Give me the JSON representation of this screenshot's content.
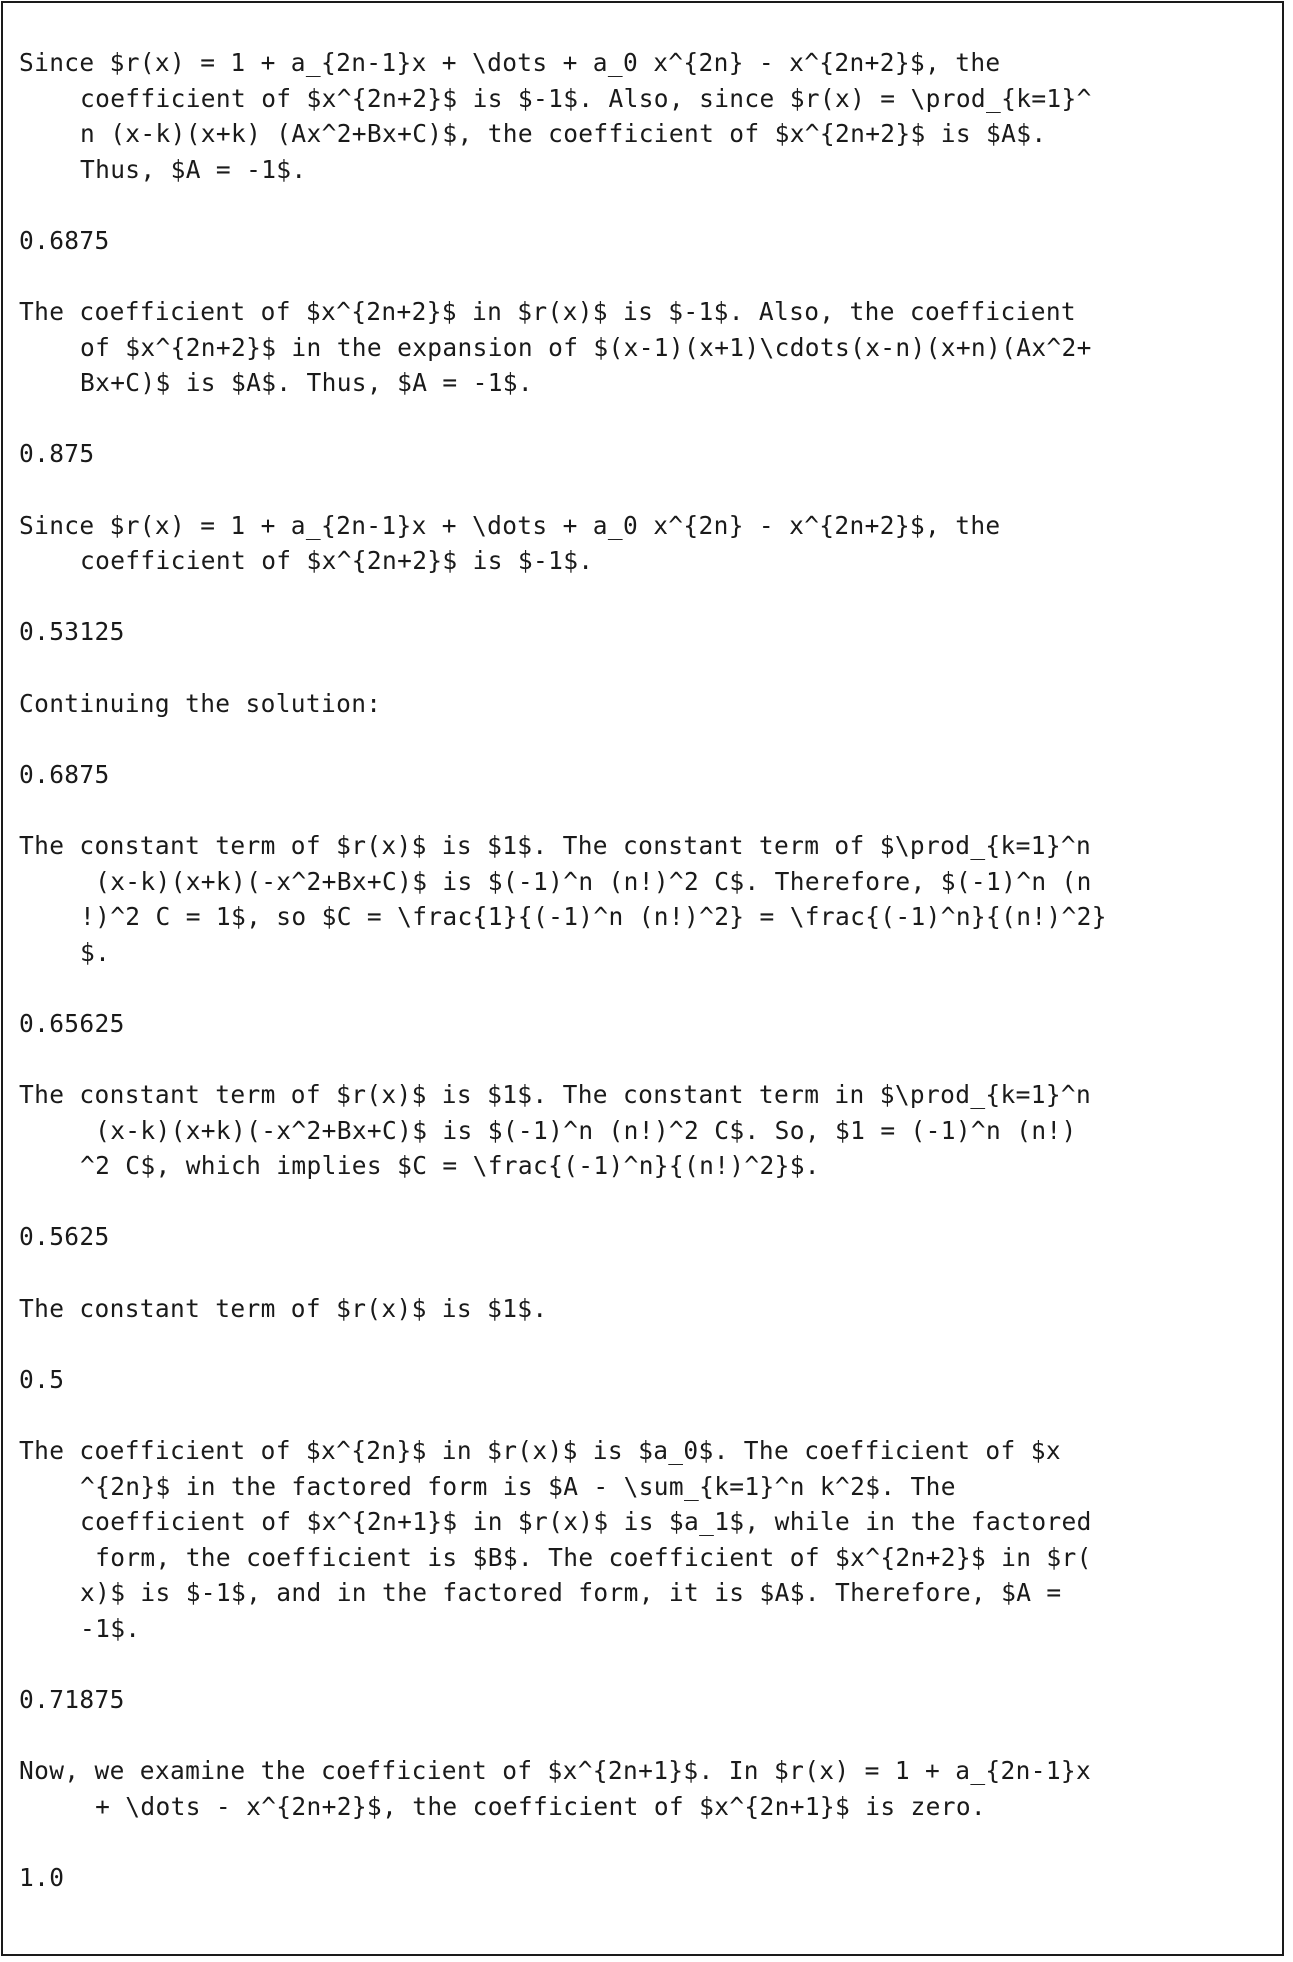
{
  "entries": [
    {
      "lines": [
        "Since $r(x) = 1 + a_{2n-1}x + \\dots + a_0 x^{2n} - x^{2n+2}$, the",
        "coefficient of $x^{2n+2}$ is $-1$. Also, since $r(x) = \\prod_{k=1}^",
        "n (x-k)(x+k) (Ax^2+Bx+C)$, the coefficient of $x^{2n+2}$ is $A$.",
        "Thus, $A = -1$."
      ],
      "score": "0.6875"
    },
    {
      "lines": [
        "The coefficient of $x^{2n+2}$ in $r(x)$ is $-1$. Also, the coefficient",
        "of $x^{2n+2}$ in the expansion of $(x-1)(x+1)\\cdots(x-n)(x+n)(Ax^2+",
        "Bx+C)$ is $A$. Thus, $A = -1$."
      ],
      "score": "0.875"
    },
    {
      "lines": [
        "Since $r(x) = 1 + a_{2n-1}x + \\dots + a_0 x^{2n} - x^{2n+2}$, the",
        "coefficient of $x^{2n+2}$ is $-1$."
      ],
      "score": "0.53125"
    },
    {
      "lines": [
        "Continuing the solution:"
      ],
      "score": "0.6875"
    },
    {
      "lines": [
        "The constant term of $r(x)$ is $1$. The constant term of $\\prod_{k=1}^n",
        " (x-k)(x+k)(-x^2+Bx+C)$ is $(-1)^n (n!)^2 C$. Therefore, $(-1)^n (n",
        "!)^2 C = 1$, so $C = \\frac{1}{(-1)^n (n!)^2} = \\frac{(-1)^n}{(n!)^2}",
        "$."
      ],
      "score": "0.65625"
    },
    {
      "lines": [
        "The constant term of $r(x)$ is $1$. The constant term in $\\prod_{k=1}^n",
        " (x-k)(x+k)(-x^2+Bx+C)$ is $(-1)^n (n!)^2 C$. So, $1 = (-1)^n (n!)",
        "^2 C$, which implies $C = \\frac{(-1)^n}{(n!)^2}$."
      ],
      "score": "0.5625"
    },
    {
      "lines": [
        "The constant term of $r(x)$ is $1$."
      ],
      "score": "0.5"
    },
    {
      "lines": [
        "The coefficient of $x^{2n}$ in $r(x)$ is $a_0$. The coefficient of $x",
        "^{2n}$ in the factored form is $A - \\sum_{k=1}^n k^2$. The",
        "coefficient of $x^{2n+1}$ in $r(x)$ is $a_1$, while in the factored",
        " form, the coefficient is $B$. The coefficient of $x^{2n+2}$ in $r(",
        "x)$ is $-1$, and in the factored form, it is $A$. Therefore, $A =",
        "-1$."
      ],
      "score": "0.71875"
    },
    {
      "lines": [
        "Now, we examine the coefficient of $x^{2n+1}$. In $r(x) = 1 + a_{2n-1}x",
        " + \\dots - x^{2n+2}$, the coefficient of $x^{2n+1}$ is zero."
      ],
      "score": "1.0"
    }
  ]
}
